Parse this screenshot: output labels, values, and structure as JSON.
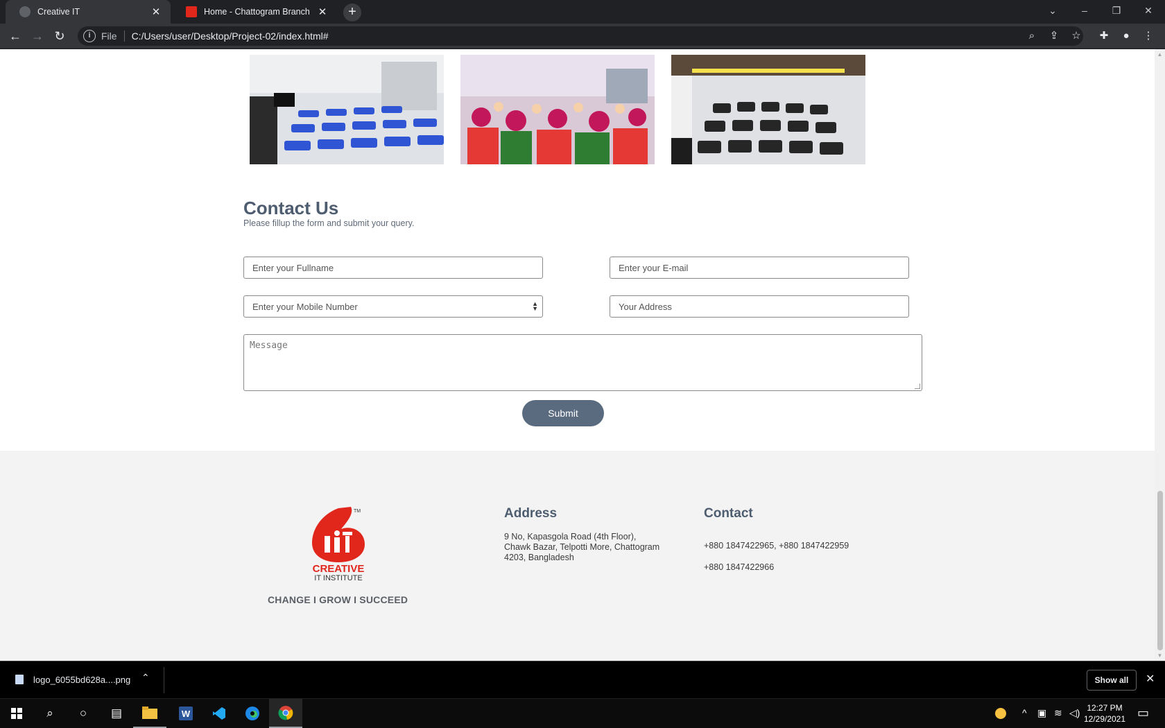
{
  "browser": {
    "tabs": [
      {
        "title": "Creative IT",
        "active": true
      },
      {
        "title": "Home - Chattogram Branch",
        "active": false
      }
    ],
    "address": {
      "scheme": "File",
      "url": "C:/Users/user/Desktop/Project-02/index.html#"
    }
  },
  "contact": {
    "title": "Contact Us",
    "subtitle": "Please fillup the form and submit your query.",
    "fullname_placeholder": "Enter your Fullname",
    "email_placeholder": "Enter your E-mail",
    "mobile_placeholder": "Enter your Mobile Number",
    "address_placeholder": "Your Address",
    "message_placeholder": "Message",
    "submit_label": "Submit"
  },
  "footer": {
    "logo_text": {
      "brand": "CREATIVE",
      "sub": "IT INSTITUTE",
      "tm": "TM"
    },
    "tagline": "CHANGE I GROW I SUCCEED",
    "address_heading": "Address",
    "address_lines": [
      "9 No, Kapasgola Road (4th Floor),",
      "Chawk Bazar, Telpotti More, Chattogram",
      "4203, Bangladesh"
    ],
    "contact_heading": "Contact",
    "phone_1": "+880 1847422965, +880 1847422959",
    "phone_2": "+880 1847422966"
  },
  "downloads": {
    "file_name": "logo_6055bd628a....png",
    "show_all_label": "Show all"
  },
  "taskbar": {
    "time": "12:27 PM",
    "date": "12/29/2021"
  },
  "colors": {
    "heading": "#4d5c6f",
    "submit": "#5a6b80",
    "footer_bg": "#f3f3f3",
    "brand_red": "#e1261c"
  }
}
